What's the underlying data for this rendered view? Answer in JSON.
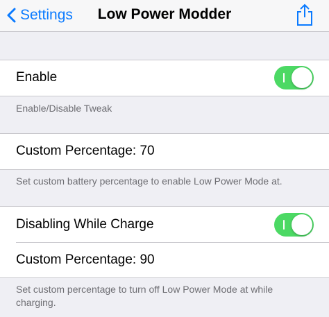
{
  "navbar": {
    "back_label": "Settings",
    "title": "Low Power Modder",
    "back_icon": "chevron-left-icon",
    "share_icon": "share-icon"
  },
  "sections": [
    {
      "rows": [
        {
          "label": "Enable",
          "toggle": {
            "on": true
          }
        }
      ],
      "footer": "Enable/Disable Tweak"
    },
    {
      "rows": [
        {
          "label": "Custom Percentage:  70"
        }
      ],
      "footer": "Set custom battery percentage to enable Low Power Mode at."
    },
    {
      "rows": [
        {
          "label": "Disabling While Charge",
          "toggle": {
            "on": true
          }
        },
        {
          "label": "Custom Percentage:  90"
        }
      ],
      "footer": "Set custom percentage to turn off Low Power Mode at while charging."
    }
  ],
  "colors": {
    "accent": "#0a7aff",
    "toggle_on": "#4cd964",
    "background": "#efeff4",
    "footer_text": "#6d6d72"
  }
}
